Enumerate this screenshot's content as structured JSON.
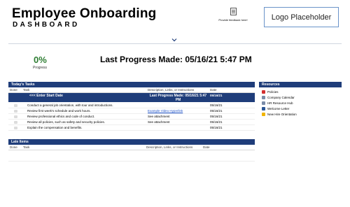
{
  "header": {
    "title": "Employee Onboarding",
    "subtitle": "DASHBOARD",
    "feedback_label": "Provide feedback here!",
    "logo_placeholder": "Logo Placeholder"
  },
  "progress": {
    "percent": "0%",
    "label": "Progress",
    "last_progress": "Last Progress Made: 05/16/21 5:47 PM"
  },
  "todays_tasks": {
    "title": "Today's Tasks",
    "columns": {
      "done": "Done",
      "task": "Task",
      "desc": "Description, Links, or Instructions",
      "date": "Date"
    },
    "start_row": {
      "task": "<<< Enter Start Date",
      "desc": "Last Progress Made: 05/16/21 5:47 PM",
      "date": "05/16/21"
    },
    "rows": [
      {
        "task": "Conduct a general job orientation, with tour and introductions.",
        "desc": "",
        "date": "05/16/21"
      },
      {
        "task": "Review first week's schedule and work hours.",
        "desc": "Example Video Hyperlink",
        "date": "05/16/21"
      },
      {
        "task": "Review professional ethics and code of conduct.",
        "desc": "See attachment",
        "date": "05/16/21"
      },
      {
        "task": "Review all policies, such as safety and security policies.",
        "desc": "See attachment",
        "date": "05/16/21"
      },
      {
        "task": "Explain the compensation and benefits.",
        "desc": "",
        "date": "05/16/21"
      }
    ]
  },
  "late_items": {
    "title": "Late Items",
    "columns": {
      "done": "Done",
      "task": "Task",
      "desc": "Description, Links, or Instructions",
      "date": "Date"
    }
  },
  "resources": {
    "title": "Resources",
    "items": [
      {
        "label": "Policies",
        "icon": "pdf-icon",
        "color": "#d32f2f"
      },
      {
        "label": "Company Calendar",
        "icon": "link-icon",
        "color": "#7a8ca8"
      },
      {
        "label": "HR Resource Hub",
        "icon": "link-icon",
        "color": "#7a8ca8"
      },
      {
        "label": "Welcome Letter",
        "icon": "word-doc-icon",
        "color": "#2b5797"
      },
      {
        "label": "New Hire Orientation",
        "icon": "slides-icon",
        "color": "#f0b400"
      }
    ]
  },
  "colors": {
    "header_blue": "#1f3d7a",
    "progress_green": "#2e7d32",
    "link_blue": "#1a4fc7"
  }
}
